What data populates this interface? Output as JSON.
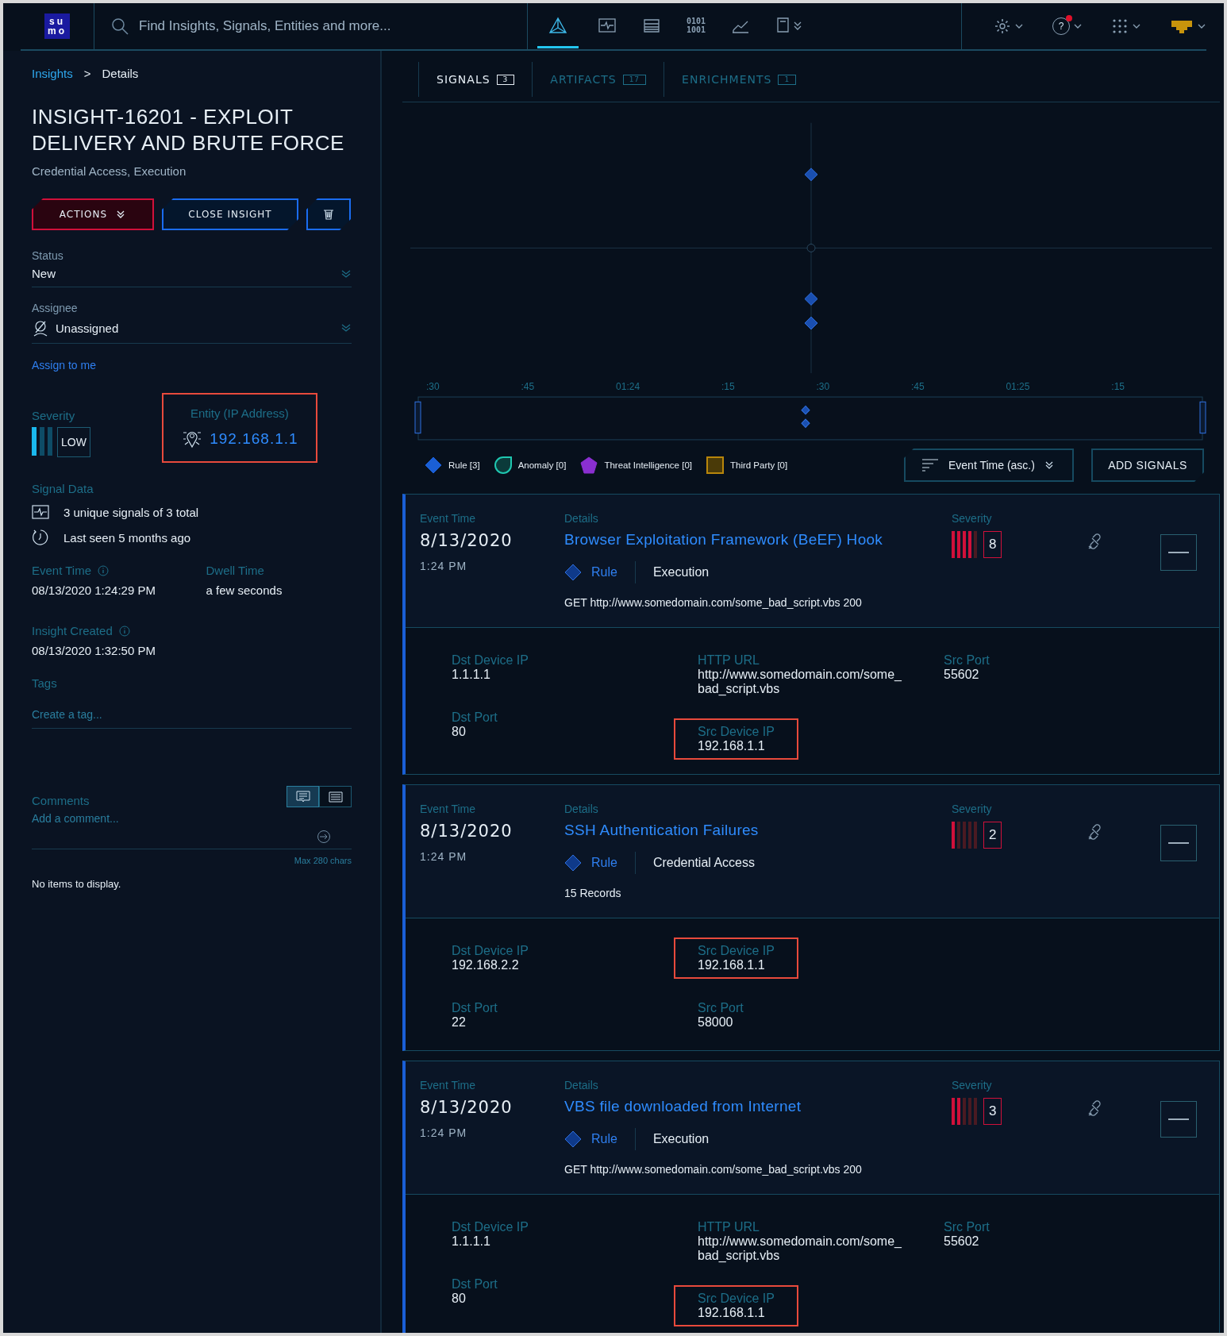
{
  "header": {
    "logo_lines": [
      "su",
      "mo"
    ],
    "search": {
      "placeholder": "Find Insights, Signals, Entities and more..."
    },
    "nav": [
      {
        "kind": "insights",
        "selected": true
      },
      {
        "kind": "pulse",
        "selected": false
      },
      {
        "kind": "records",
        "selected": false
      },
      {
        "kind": "binary",
        "lines": [
          "0101",
          "1001"
        ],
        "selected": false
      },
      {
        "kind": "chart",
        "selected": false
      },
      {
        "kind": "book",
        "selected": false
      }
    ],
    "tools": [
      {
        "kind": "gear"
      },
      {
        "kind": "help",
        "glyph": "?",
        "alert": true
      },
      {
        "kind": "apps"
      },
      {
        "kind": "org"
      }
    ]
  },
  "breadcrumb": {
    "items": [
      "Insights",
      "Details"
    ],
    "separator": ">"
  },
  "insight": {
    "title": "INSIGHT-16201 - EXPLOIT DELIVERY AND BRUTE FORCE",
    "tactics": "Credential Access, Execution",
    "actions": {
      "actions": "ACTIONS",
      "close": "CLOSE INSIGHT"
    },
    "status": {
      "label": "Status",
      "value": "New"
    },
    "assignee": {
      "label": "Assignee",
      "value": "Unassigned",
      "assign_link": "Assign to me"
    },
    "severity": {
      "label": "Severity",
      "level": 0.33,
      "text": "LOW"
    },
    "entity": {
      "label": "Entity (IP Address)",
      "value": "192.168.1.1",
      "highlighted": true
    },
    "signal_data": {
      "label": "Signal Data",
      "items": [
        {
          "kind": "signals",
          "text": "3 unique signals of 3 total"
        },
        {
          "kind": "clock",
          "text": "Last seen 5 months ago"
        }
      ]
    },
    "times": [
      {
        "label": "Event Time",
        "info": true,
        "value": "08/13/2020 1:24:29 PM"
      },
      {
        "label": "Dwell Time",
        "info": false,
        "value": "a few seconds"
      }
    ],
    "created": {
      "label": "Insight Created",
      "info": true,
      "value": "08/13/2020 1:32:50 PM"
    },
    "tags": {
      "label": "Tags",
      "placeholder": "Create a tag..."
    },
    "comments": {
      "label": "Comments",
      "views": [
        {
          "kind": "comment",
          "selected": true
        },
        {
          "kind": "list",
          "selected": false
        }
      ],
      "placeholder": "Add a comment...",
      "limit": "Max 280 chars",
      "empty": "No items to display."
    }
  },
  "tabs": [
    {
      "label": "SIGNALS",
      "count": "3",
      "selected": true
    },
    {
      "label": "ARTIFACTS",
      "count": "17",
      "selected": false
    },
    {
      "label": "ENRICHMENTS",
      "count": "1",
      "selected": false
    }
  ],
  "timeline": {
    "ticks": [
      ":30",
      ":45",
      "01:24",
      ":15",
      ":30",
      ":45",
      "01:25",
      ":15"
    ]
  },
  "legend": [
    {
      "kind": "rule",
      "label": "Rule [3]",
      "color": "#1a5fd6"
    },
    {
      "kind": "anomaly",
      "label": "Anomaly [0]",
      "color": "#1fc7b0"
    },
    {
      "kind": "threat",
      "label": "Threat Intelligence [0]",
      "color": "#8a2fd0"
    },
    {
      "kind": "third",
      "label": "Third Party [0]",
      "color": "#b8860b"
    }
  ],
  "sort": {
    "label": "Event Time (asc.)"
  },
  "add_signals": "ADD SIGNALS",
  "signals": [
    {
      "event_label": "Event Time",
      "date": "8/13/2020",
      "time": "1:24 PM",
      "details_label": "Details",
      "name": "Browser Exploitation Framework (BeEF) Hook",
      "type": "Rule",
      "tactic": "Execution",
      "summary": "GET http://www.somedomain.com/some_bad_script.vbs 200",
      "severity_label": "Severity",
      "severity": "8",
      "level": 0.8,
      "columns": [
        [
          {
            "label": "Dst Device IP",
            "value": "1.1.1.1",
            "highlighted": false
          },
          {
            "label": "Dst Port",
            "value": "80",
            "highlighted": false
          }
        ],
        [
          {
            "label": "HTTP URL",
            "value": "http://www.somedomain.com/some_ bad_script.vbs",
            "highlighted": false
          },
          {
            "label": "Src Device IP",
            "value": "192.168.1.1",
            "highlighted": true
          }
        ],
        [
          {
            "label": "Src Port",
            "value": "55602",
            "highlighted": false
          }
        ]
      ]
    },
    {
      "event_label": "Event Time",
      "date": "8/13/2020",
      "time": "1:24 PM",
      "details_label": "Details",
      "name": "SSH Authentication Failures",
      "type": "Rule",
      "tactic": "Credential Access",
      "summary": "15 Records",
      "severity_label": "Severity",
      "severity": "2",
      "level": 0.2,
      "columns": [
        [
          {
            "label": "Dst Device IP",
            "value": "192.168.2.2",
            "highlighted": false
          },
          {
            "label": "Dst Port",
            "value": "22",
            "highlighted": false
          }
        ],
        [
          {
            "label": "Src Device IP",
            "value": "192.168.1.1",
            "highlighted": true
          },
          {
            "label": "Src Port",
            "value": "58000",
            "highlighted": false
          }
        ]
      ]
    },
    {
      "event_label": "Event Time",
      "date": "8/13/2020",
      "time": "1:24 PM",
      "details_label": "Details",
      "name": "VBS file downloaded from Internet",
      "type": "Rule",
      "tactic": "Execution",
      "summary": "GET http://www.somedomain.com/some_bad_script.vbs 200",
      "severity_label": "Severity",
      "severity": "3",
      "level": 0.4,
      "columns": [
        [
          {
            "label": "Dst Device IP",
            "value": "1.1.1.1",
            "highlighted": false
          },
          {
            "label": "Dst Port",
            "value": "80",
            "highlighted": false
          }
        ],
        [
          {
            "label": "HTTP URL",
            "value": "http://www.somedomain.com/some_ bad_script.vbs",
            "highlighted": false
          },
          {
            "label": "Src Device IP",
            "value": "192.168.1.1",
            "highlighted": true
          }
        ],
        [
          {
            "label": "Src Port",
            "value": "55602",
            "highlighted": false
          }
        ]
      ]
    }
  ]
}
